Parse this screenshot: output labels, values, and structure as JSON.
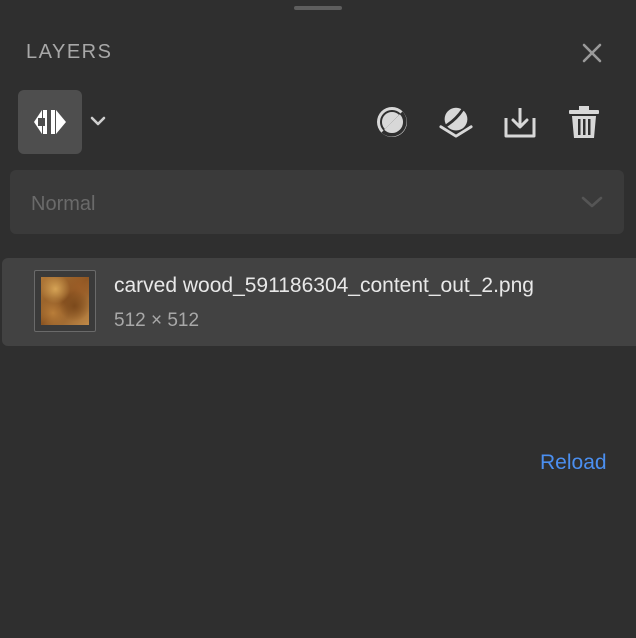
{
  "panel": {
    "title": "LAYERS"
  },
  "toolbar": {
    "mode_icon": "compare-split-icon",
    "tools": [
      {
        "icon": "adjustment-icon"
      },
      {
        "icon": "material-sphere-icon"
      },
      {
        "icon": "import-layer-icon"
      },
      {
        "icon": "trash-icon"
      }
    ]
  },
  "blend_mode": {
    "value": "Normal"
  },
  "layers": [
    {
      "name": "carved wood_591186304_content_out_2.png",
      "size": "512 × 512"
    }
  ],
  "actions": {
    "reload_label": "Reload"
  },
  "colors": {
    "background": "#2f2f2f",
    "accent": "#4b8ff0",
    "row": "#424242"
  }
}
